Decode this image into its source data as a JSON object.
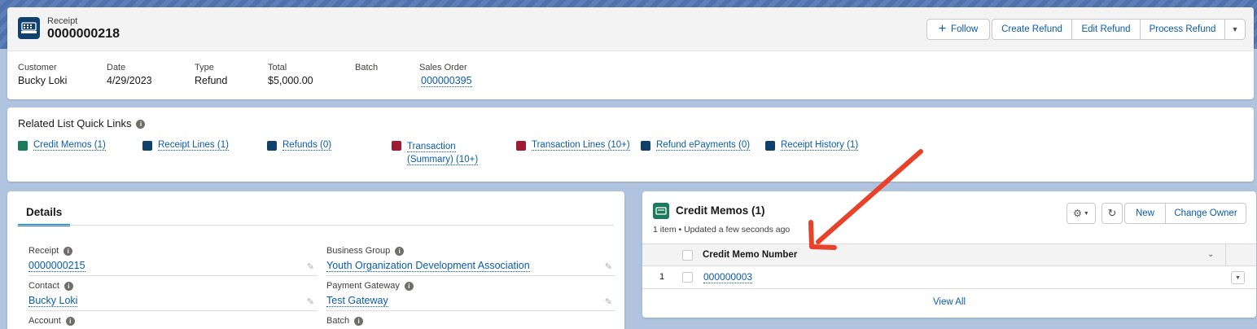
{
  "record": {
    "object_label": "Receipt",
    "name": "0000000218",
    "actions": {
      "follow": "Follow",
      "create_refund": "Create Refund",
      "edit_refund": "Edit Refund",
      "process_refund": "Process Refund"
    },
    "highlights": [
      {
        "label": "Customer",
        "value": "Bucky Loki"
      },
      {
        "label": "Date",
        "value": "4/29/2023"
      },
      {
        "label": "Type",
        "value": "Refund"
      },
      {
        "label": "Total",
        "value": "$5,000.00"
      },
      {
        "label": "Batch",
        "value": ""
      },
      {
        "label": "Sales Order",
        "value": "000000395"
      }
    ]
  },
  "quick_links": {
    "title": "Related List Quick Links",
    "items": [
      {
        "label": "Credit Memos (1)",
        "icon": "credit-memo-icon",
        "color": "#1b7a5a"
      },
      {
        "label": "Receipt Lines (1)",
        "icon": "receipt-icon",
        "color": "#11406d"
      },
      {
        "label": "Refunds (0)",
        "icon": "receipt-icon",
        "color": "#11406d"
      },
      {
        "label": "Transaction",
        "label2": "(Summary) (10+)",
        "icon": "transaction-icon",
        "color": "#9e1b32"
      },
      {
        "label": "Transaction Lines (10+)",
        "icon": "transaction-icon",
        "color": "#9e1b32"
      },
      {
        "label": "Refund ePayments (0)",
        "icon": "epayment-icon",
        "color": "#11406d"
      },
      {
        "label": "Receipt History (1)",
        "icon": "receipt-icon",
        "color": "#11406d"
      }
    ]
  },
  "details": {
    "tab": "Details",
    "fields": {
      "receipt": {
        "label": "Receipt",
        "value": "0000000215"
      },
      "business_group": {
        "label": "Business Group",
        "value": "Youth Organization Development Association"
      },
      "contact": {
        "label": "Contact",
        "value": "Bucky Loki"
      },
      "payment_gateway": {
        "label": "Payment Gateway",
        "value": "Test Gateway"
      },
      "account": {
        "label": "Account",
        "value": ""
      },
      "batch": {
        "label": "Batch",
        "value": ""
      }
    }
  },
  "credit_memos": {
    "title": "Credit Memos (1)",
    "subtitle": "1 item • Updated a few seconds ago",
    "new_label": "New",
    "change_owner_label": "Change Owner",
    "column": "Credit Memo Number",
    "rows": [
      {
        "num": "1",
        "value": "000000003"
      }
    ],
    "view_all": "View All"
  },
  "colors": {
    "brand": "#0176d3",
    "link": "#0b5cab",
    "arrow": "#e8432a"
  }
}
